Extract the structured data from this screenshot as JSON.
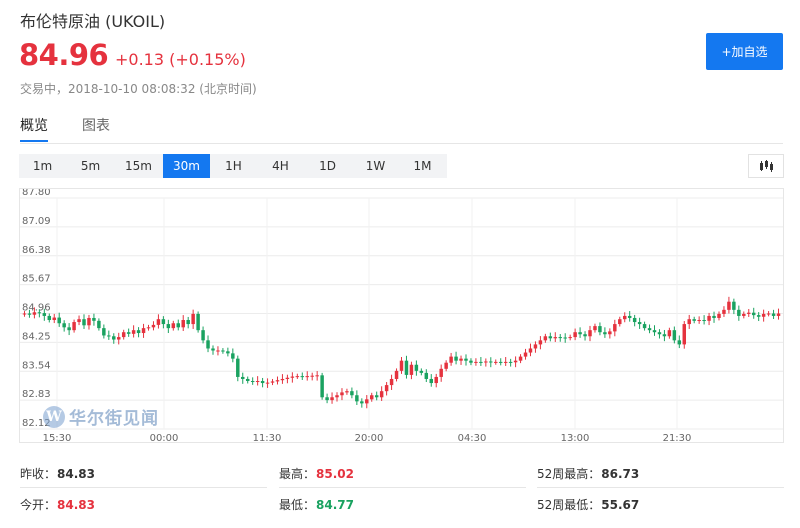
{
  "header": {
    "title": "布伦特原油 (UKOIL)",
    "price": "84.96",
    "change": "+0.13 (+0.15%)",
    "status": "交易中，2018-10-10 08:08:32 (北京时间)",
    "add_button": "+加自选"
  },
  "tabs": [
    {
      "label": "概览",
      "active": true
    },
    {
      "label": "图表",
      "active": false
    }
  ],
  "ranges": [
    {
      "label": "1m",
      "active": false
    },
    {
      "label": "5m",
      "active": false
    },
    {
      "label": "15m",
      "active": false
    },
    {
      "label": "30m",
      "active": true
    },
    {
      "label": "1H",
      "active": false
    },
    {
      "label": "4H",
      "active": false
    },
    {
      "label": "1D",
      "active": false
    },
    {
      "label": "1W",
      "active": false
    },
    {
      "label": "1M",
      "active": false
    }
  ],
  "watermark": "华尔街见闻",
  "colors": {
    "up": "#e5323e",
    "down": "#1aa260",
    "accent": "#1478f0"
  },
  "chart_data": {
    "type": "candlestick",
    "interval": "30m",
    "y_ticks": [
      87.8,
      87.09,
      86.38,
      85.67,
      84.96,
      84.25,
      83.54,
      82.83,
      82.12
    ],
    "ylim": [
      82.12,
      87.8
    ],
    "x_labels": [
      "15:30",
      "00:00",
      "11:30",
      "20:00",
      "04:30",
      "13:00",
      "21:30"
    ],
    "grid": true,
    "closes": [
      84.96,
      84.93,
      84.99,
      84.97,
      84.9,
      84.8,
      84.86,
      84.72,
      84.62,
      84.55,
      84.75,
      84.82,
      84.67,
      84.85,
      84.78,
      84.6,
      84.42,
      84.4,
      84.32,
      84.38,
      84.5,
      84.46,
      84.55,
      84.48,
      84.6,
      84.62,
      84.68,
      84.82,
      84.7,
      84.6,
      84.72,
      84.62,
      84.8,
      84.7,
      84.95,
      84.55,
      84.3,
      84.1,
      84.05,
      84.05,
      84.03,
      83.98,
      83.85,
      83.4,
      83.35,
      83.3,
      83.28,
      83.3,
      83.25,
      83.26,
      83.29,
      83.32,
      83.35,
      83.38,
      83.41,
      83.42,
      83.4,
      83.42,
      83.43,
      83.44,
      82.9,
      82.83,
      82.9,
      82.95,
      83.02,
      83.05,
      82.95,
      82.8,
      82.75,
      82.85,
      82.95,
      82.9,
      83.05,
      83.2,
      83.35,
      83.55,
      83.8,
      83.45,
      83.7,
      83.55,
      83.5,
      83.35,
      83.25,
      83.4,
      83.6,
      83.75,
      83.9,
      83.8,
      83.85,
      83.8,
      83.75,
      83.77,
      83.76,
      83.78,
      83.76,
      83.77,
      83.76,
      83.77,
      83.76,
      83.8,
      83.9,
      84.0,
      84.1,
      84.2,
      84.3,
      84.4,
      84.35,
      84.38,
      84.37,
      84.36,
      84.38,
      84.5,
      84.45,
      84.4,
      84.55,
      84.65,
      84.5,
      84.45,
      84.52,
      84.7,
      84.82,
      84.9,
      84.85,
      84.75,
      84.7,
      84.6,
      84.55,
      84.5,
      84.45,
      84.4,
      84.55,
      84.3,
      84.2,
      84.7,
      84.82,
      84.78,
      84.8,
      84.78,
      84.9,
      84.85,
      84.95,
      85.05,
      85.25,
      85.05,
      84.9,
      84.95,
      84.98,
      84.92,
      84.88,
      84.95,
      84.96,
      84.9,
      84.96
    ]
  }
}
